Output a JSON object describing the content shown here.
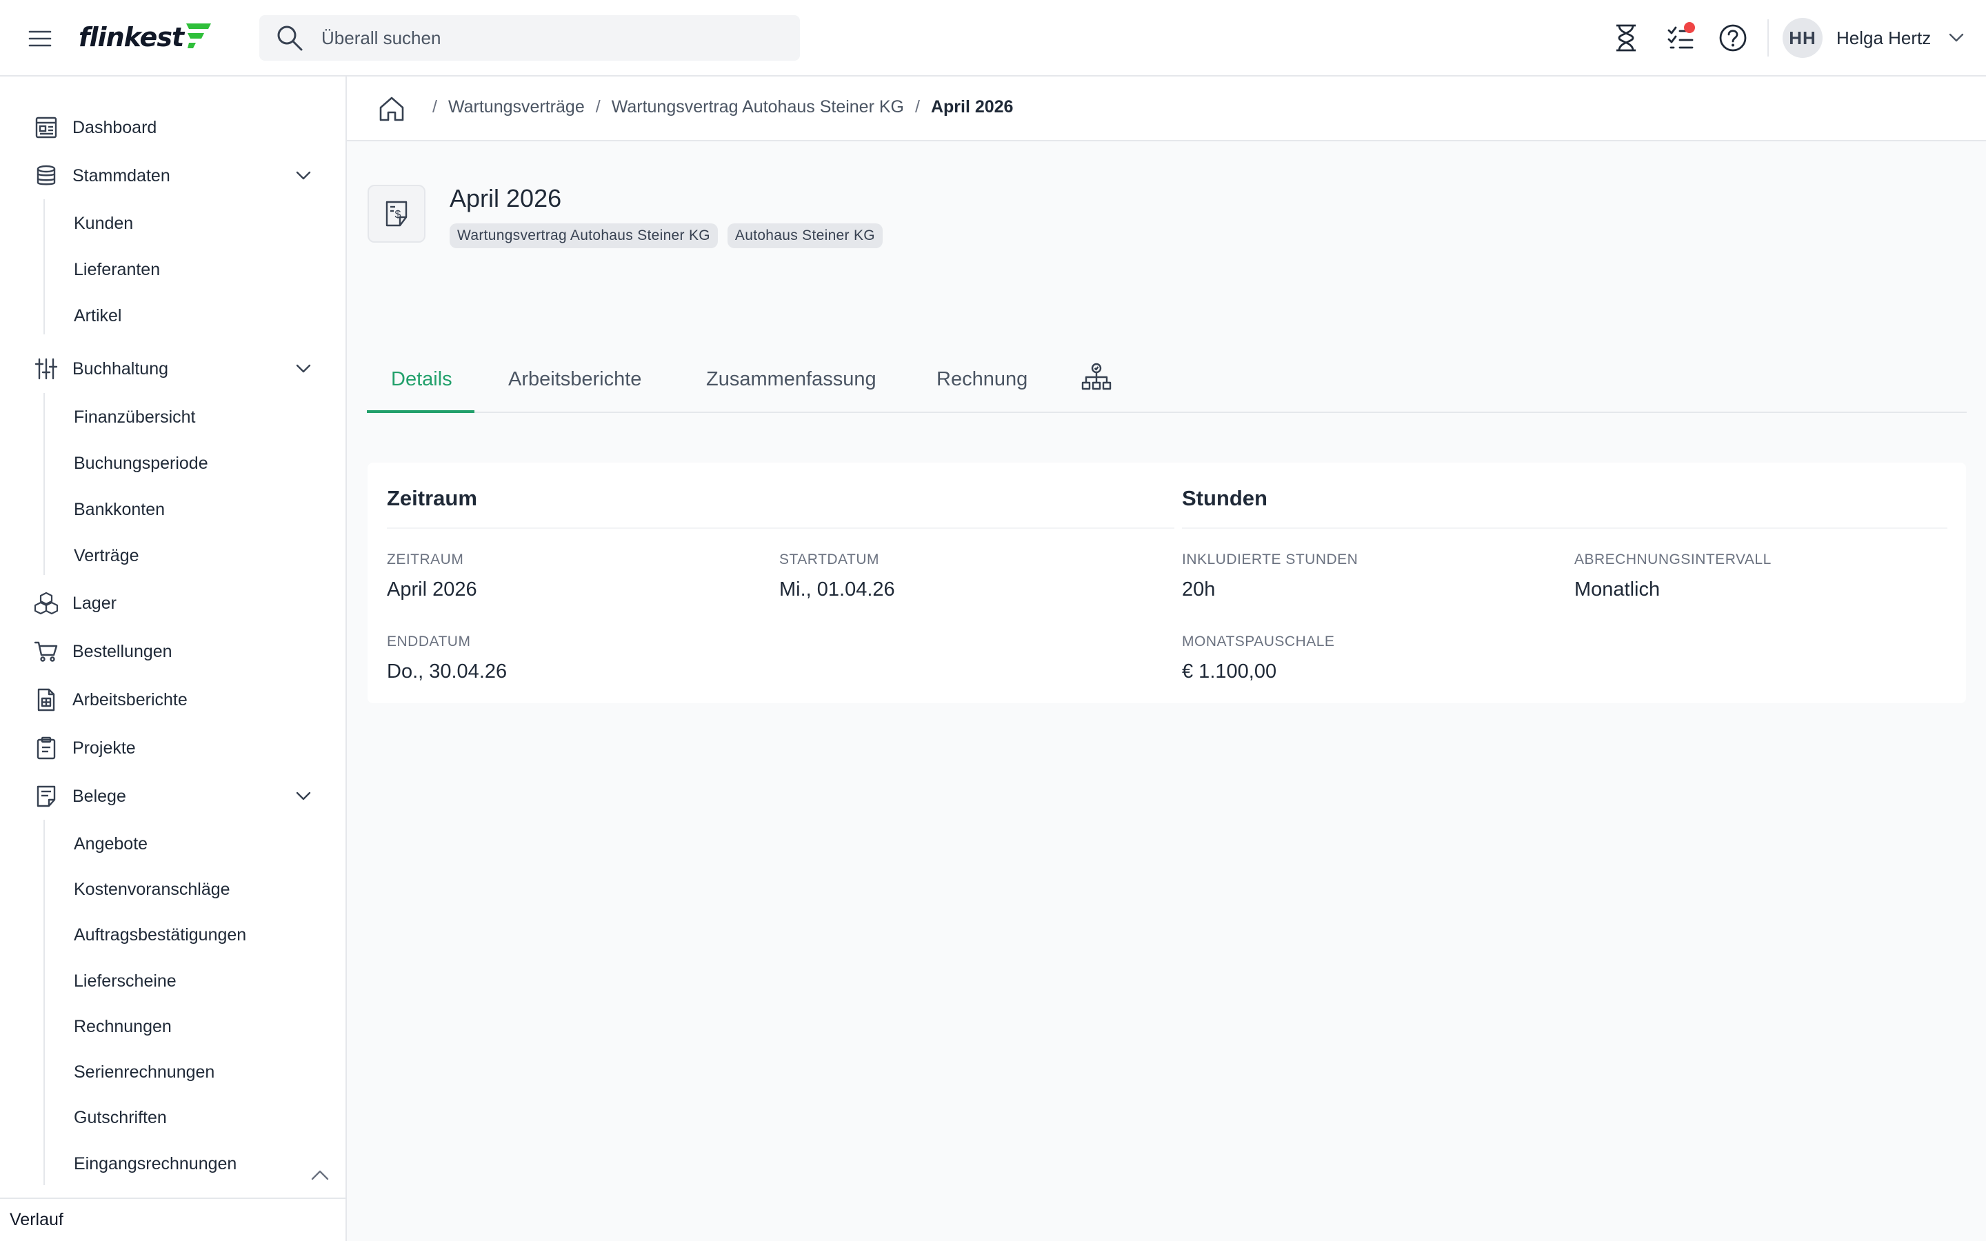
{
  "brand": {
    "logo_text": "flinkest",
    "accent": "#22a06b",
    "logo_accent": "#2fbf3a"
  },
  "search": {
    "placeholder": "Überall suchen"
  },
  "topbar": {
    "icons": [
      "hourglass-icon",
      "task-list-icon",
      "help-icon"
    ],
    "notification_dot_color": "#ef4444"
  },
  "user": {
    "initials": "HH",
    "name": "Helga Hertz"
  },
  "sidebar": {
    "items": [
      {
        "label": "Dashboard",
        "icon": "dashboard-icon"
      },
      {
        "label": "Stammdaten",
        "icon": "database-icon",
        "expanded": true,
        "children": [
          "Kunden",
          "Lieferanten",
          "Artikel"
        ]
      },
      {
        "label": "Buchhaltung",
        "icon": "sliders-icon",
        "expanded": true,
        "children": [
          "Finanzübersicht",
          "Buchungsperiode",
          "Bankkonten",
          "Verträge"
        ]
      },
      {
        "label": "Lager",
        "icon": "boxes-icon"
      },
      {
        "label": "Bestellungen",
        "icon": "cart-icon"
      },
      {
        "label": "Arbeitsberichte",
        "icon": "report-icon"
      },
      {
        "label": "Projekte",
        "icon": "clipboard-icon"
      },
      {
        "label": "Belege",
        "icon": "receipt-icon",
        "expanded": true,
        "children": [
          "Angebote",
          "Kostenvoranschläge",
          "Auftragsbestätigungen",
          "Lieferscheine",
          "Rechnungen",
          "Serienrechnungen",
          "Gutschriften",
          "Eingangsrechnungen"
        ]
      }
    ],
    "footer_label": "Verlauf"
  },
  "breadcrumb": {
    "items": [
      "Wartungsverträge",
      "Wartungsvertrag Autohaus Steiner KG"
    ],
    "current": "April 2026"
  },
  "record": {
    "title": "April 2026",
    "icon": "invoice-document-icon",
    "tags": [
      "Wartungsvertrag Autohaus Steiner KG",
      "Autohaus Steiner KG"
    ]
  },
  "tabs": {
    "items": [
      "Details",
      "Arbeitsberichte",
      "Zusammenfassung",
      "Rechnung"
    ],
    "active": "Details",
    "extra_icon": "hierarchy-icon"
  },
  "details": {
    "zeitraum": {
      "title": "Zeitraum",
      "fields": [
        {
          "label": "ZEITRAUM",
          "value": "April 2026"
        },
        {
          "label": "STARTDATUM",
          "value": "Mi., 01.04.26"
        },
        {
          "label": "ENDDATUM",
          "value": "Do., 30.04.26"
        }
      ]
    },
    "stunden": {
      "title": "Stunden",
      "fields": [
        {
          "label": "INKLUDIERTE STUNDEN",
          "value": "20h"
        },
        {
          "label": "ABRECHNUNGSINTERVALL",
          "value": "Monatlich"
        },
        {
          "label": "MONATSPAUSCHALE",
          "value": "€ 1.100,00"
        }
      ]
    }
  }
}
